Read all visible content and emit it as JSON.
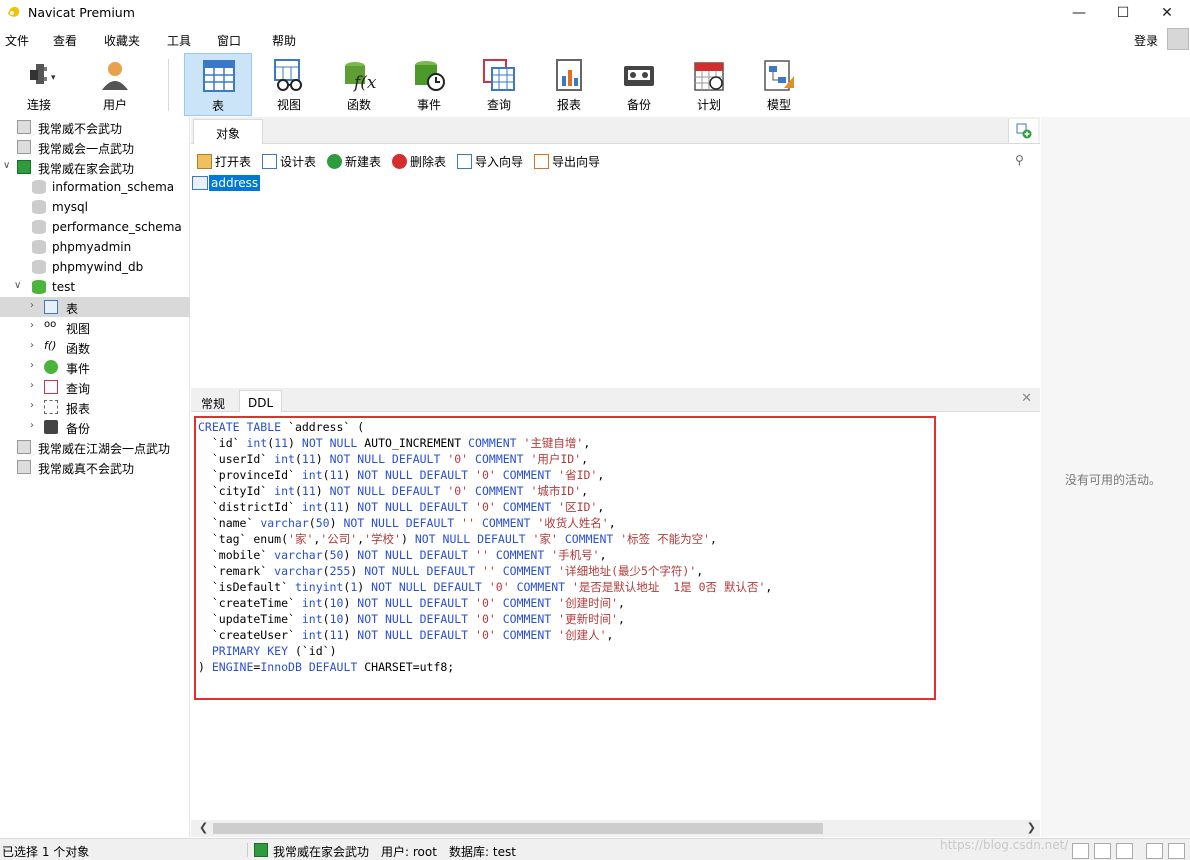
{
  "app": {
    "title": "Navicat Premium"
  },
  "menu": [
    "文件",
    "查看",
    "收藏夹",
    "工具",
    "窗口",
    "帮助"
  ],
  "account": {
    "login": "登录"
  },
  "toolbar": {
    "connect": "连接",
    "user": "用户",
    "items": [
      "表",
      "视图",
      "函数",
      "事件",
      "查询",
      "报表",
      "备份",
      "计划",
      "模型"
    ]
  },
  "tree": {
    "conn1": "我常威不会武功",
    "conn2": "我常威会一点武功",
    "conn3": "我常威在家会武功",
    "dbs": [
      "information_schema",
      "mysql",
      "performance_schema",
      "phpmyadmin",
      "phpmywind_db",
      "test"
    ],
    "test_children": [
      "表",
      "视图",
      "函数",
      "事件",
      "查询",
      "报表",
      "备份"
    ],
    "conn4": "我常威在江湖会一点武功",
    "conn5": "我常威真不会武功"
  },
  "objects": {
    "tab": "对象",
    "actions": [
      "打开表",
      "设计表",
      "新建表",
      "删除表",
      "导入向导",
      "导出向导"
    ],
    "selected": "address"
  },
  "lower": {
    "tabs": [
      "常规",
      "DDL"
    ]
  },
  "ddl": [
    [
      [
        "k",
        "CREATE TABLE"
      ],
      [
        "t",
        " `address` ("
      ]
    ],
    [
      [
        "t",
        "  `id` "
      ],
      [
        "k",
        "int"
      ],
      [
        "t",
        "("
      ],
      [
        "k",
        "11"
      ],
      [
        "t",
        ") "
      ],
      [
        "k",
        "NOT NULL"
      ],
      [
        "t",
        " AUTO_INCREMENT "
      ],
      [
        "k",
        "COMMENT"
      ],
      [
        "t",
        " "
      ],
      [
        "s",
        "'主键自增'"
      ],
      [
        "t",
        ","
      ]
    ],
    [
      [
        "t",
        "  `userId` "
      ],
      [
        "k",
        "int"
      ],
      [
        "t",
        "("
      ],
      [
        "k",
        "11"
      ],
      [
        "t",
        ") "
      ],
      [
        "k",
        "NOT NULL DEFAULT"
      ],
      [
        "t",
        " "
      ],
      [
        "s",
        "'0'"
      ],
      [
        "t",
        " "
      ],
      [
        "k",
        "COMMENT"
      ],
      [
        "t",
        " "
      ],
      [
        "s",
        "'用户ID'"
      ],
      [
        "t",
        ","
      ]
    ],
    [
      [
        "t",
        "  `provinceId` "
      ],
      [
        "k",
        "int"
      ],
      [
        "t",
        "("
      ],
      [
        "k",
        "11"
      ],
      [
        "t",
        ") "
      ],
      [
        "k",
        "NOT NULL DEFAULT"
      ],
      [
        "t",
        " "
      ],
      [
        "s",
        "'0'"
      ],
      [
        "t",
        " "
      ],
      [
        "k",
        "COMMENT"
      ],
      [
        "t",
        " "
      ],
      [
        "s",
        "'省ID'"
      ],
      [
        "t",
        ","
      ]
    ],
    [
      [
        "t",
        "  `cityId` "
      ],
      [
        "k",
        "int"
      ],
      [
        "t",
        "("
      ],
      [
        "k",
        "11"
      ],
      [
        "t",
        ") "
      ],
      [
        "k",
        "NOT NULL DEFAULT"
      ],
      [
        "t",
        " "
      ],
      [
        "s",
        "'0'"
      ],
      [
        "t",
        " "
      ],
      [
        "k",
        "COMMENT"
      ],
      [
        "t",
        " "
      ],
      [
        "s",
        "'城市ID'"
      ],
      [
        "t",
        ","
      ]
    ],
    [
      [
        "t",
        "  `districtId` "
      ],
      [
        "k",
        "int"
      ],
      [
        "t",
        "("
      ],
      [
        "k",
        "11"
      ],
      [
        "t",
        ") "
      ],
      [
        "k",
        "NOT NULL DEFAULT"
      ],
      [
        "t",
        " "
      ],
      [
        "s",
        "'0'"
      ],
      [
        "t",
        " "
      ],
      [
        "k",
        "COMMENT"
      ],
      [
        "t",
        " "
      ],
      [
        "s",
        "'区ID'"
      ],
      [
        "t",
        ","
      ]
    ],
    [
      [
        "t",
        "  `name` "
      ],
      [
        "k",
        "varchar"
      ],
      [
        "t",
        "("
      ],
      [
        "k",
        "50"
      ],
      [
        "t",
        ") "
      ],
      [
        "k",
        "NOT NULL DEFAULT"
      ],
      [
        "t",
        " "
      ],
      [
        "s",
        "''"
      ],
      [
        "t",
        " "
      ],
      [
        "k",
        "COMMENT"
      ],
      [
        "t",
        " "
      ],
      [
        "s",
        "'收货人姓名'"
      ],
      [
        "t",
        ","
      ]
    ],
    [
      [
        "t",
        "  `tag` enum("
      ],
      [
        "s",
        "'家'"
      ],
      [
        "t",
        ","
      ],
      [
        "s",
        "'公司'"
      ],
      [
        "t",
        ","
      ],
      [
        "s",
        "'学校'"
      ],
      [
        "t",
        ") "
      ],
      [
        "k",
        "NOT NULL DEFAULT"
      ],
      [
        "t",
        " "
      ],
      [
        "s",
        "'家'"
      ],
      [
        "t",
        " "
      ],
      [
        "k",
        "COMMENT"
      ],
      [
        "t",
        " "
      ],
      [
        "s",
        "'标签 不能为空'"
      ],
      [
        "t",
        ","
      ]
    ],
    [
      [
        "t",
        "  `mobile` "
      ],
      [
        "k",
        "varchar"
      ],
      [
        "t",
        "("
      ],
      [
        "k",
        "50"
      ],
      [
        "t",
        ") "
      ],
      [
        "k",
        "NOT NULL DEFAULT"
      ],
      [
        "t",
        " "
      ],
      [
        "s",
        "''"
      ],
      [
        "t",
        " "
      ],
      [
        "k",
        "COMMENT"
      ],
      [
        "t",
        " "
      ],
      [
        "s",
        "'手机号'"
      ],
      [
        "t",
        ","
      ]
    ],
    [
      [
        "t",
        "  `remark` "
      ],
      [
        "k",
        "varchar"
      ],
      [
        "t",
        "("
      ],
      [
        "k",
        "255"
      ],
      [
        "t",
        ") "
      ],
      [
        "k",
        "NOT NULL DEFAULT"
      ],
      [
        "t",
        " "
      ],
      [
        "s",
        "''"
      ],
      [
        "t",
        " "
      ],
      [
        "k",
        "COMMENT"
      ],
      [
        "t",
        " "
      ],
      [
        "s",
        "'详细地址(最少5个字符)'"
      ],
      [
        "t",
        ","
      ]
    ],
    [
      [
        "t",
        "  `isDefault` "
      ],
      [
        "k",
        "tinyint"
      ],
      [
        "t",
        "("
      ],
      [
        "k",
        "1"
      ],
      [
        "t",
        ") "
      ],
      [
        "k",
        "NOT NULL DEFAULT"
      ],
      [
        "t",
        " "
      ],
      [
        "s",
        "'0'"
      ],
      [
        "t",
        " "
      ],
      [
        "k",
        "COMMENT"
      ],
      [
        "t",
        " "
      ],
      [
        "s",
        "'是否是默认地址  1是 0否 默认否'"
      ],
      [
        "t",
        ","
      ]
    ],
    [
      [
        "t",
        "  `createTime` "
      ],
      [
        "k",
        "int"
      ],
      [
        "t",
        "("
      ],
      [
        "k",
        "10"
      ],
      [
        "t",
        ") "
      ],
      [
        "k",
        "NOT NULL DEFAULT"
      ],
      [
        "t",
        " "
      ],
      [
        "s",
        "'0'"
      ],
      [
        "t",
        " "
      ],
      [
        "k",
        "COMMENT"
      ],
      [
        "t",
        " "
      ],
      [
        "s",
        "'创建时间'"
      ],
      [
        "t",
        ","
      ]
    ],
    [
      [
        "t",
        "  `updateTime` "
      ],
      [
        "k",
        "int"
      ],
      [
        "t",
        "("
      ],
      [
        "k",
        "10"
      ],
      [
        "t",
        ") "
      ],
      [
        "k",
        "NOT NULL DEFAULT"
      ],
      [
        "t",
        " "
      ],
      [
        "s",
        "'0'"
      ],
      [
        "t",
        " "
      ],
      [
        "k",
        "COMMENT"
      ],
      [
        "t",
        " "
      ],
      [
        "s",
        "'更新时间'"
      ],
      [
        "t",
        ","
      ]
    ],
    [
      [
        "t",
        "  `createUser` "
      ],
      [
        "k",
        "int"
      ],
      [
        "t",
        "("
      ],
      [
        "k",
        "11"
      ],
      [
        "t",
        ") "
      ],
      [
        "k",
        "NOT NULL DEFAULT"
      ],
      [
        "t",
        " "
      ],
      [
        "s",
        "'0'"
      ],
      [
        "t",
        " "
      ],
      [
        "k",
        "COMMENT"
      ],
      [
        "t",
        " "
      ],
      [
        "s",
        "'创建人'"
      ],
      [
        "t",
        ","
      ]
    ],
    [
      [
        "t",
        "  "
      ],
      [
        "k",
        "PRIMARY KEY"
      ],
      [
        "t",
        " (`id`)"
      ]
    ],
    [
      [
        "t",
        ") "
      ],
      [
        "k",
        "ENGINE"
      ],
      [
        "t",
        "="
      ],
      [
        "k",
        "InnoDB"
      ],
      [
        "t",
        " "
      ],
      [
        "k",
        "DEFAULT"
      ],
      [
        "t",
        " CHARSET=utf8;"
      ]
    ]
  ],
  "activity": "没有可用的活动。",
  "status": {
    "selected": "已选择 1 个对象",
    "connection": "我常威在家会武功",
    "user": "用户: root",
    "database": "数据库: test"
  },
  "watermark": "https://blog.csdn.net/"
}
